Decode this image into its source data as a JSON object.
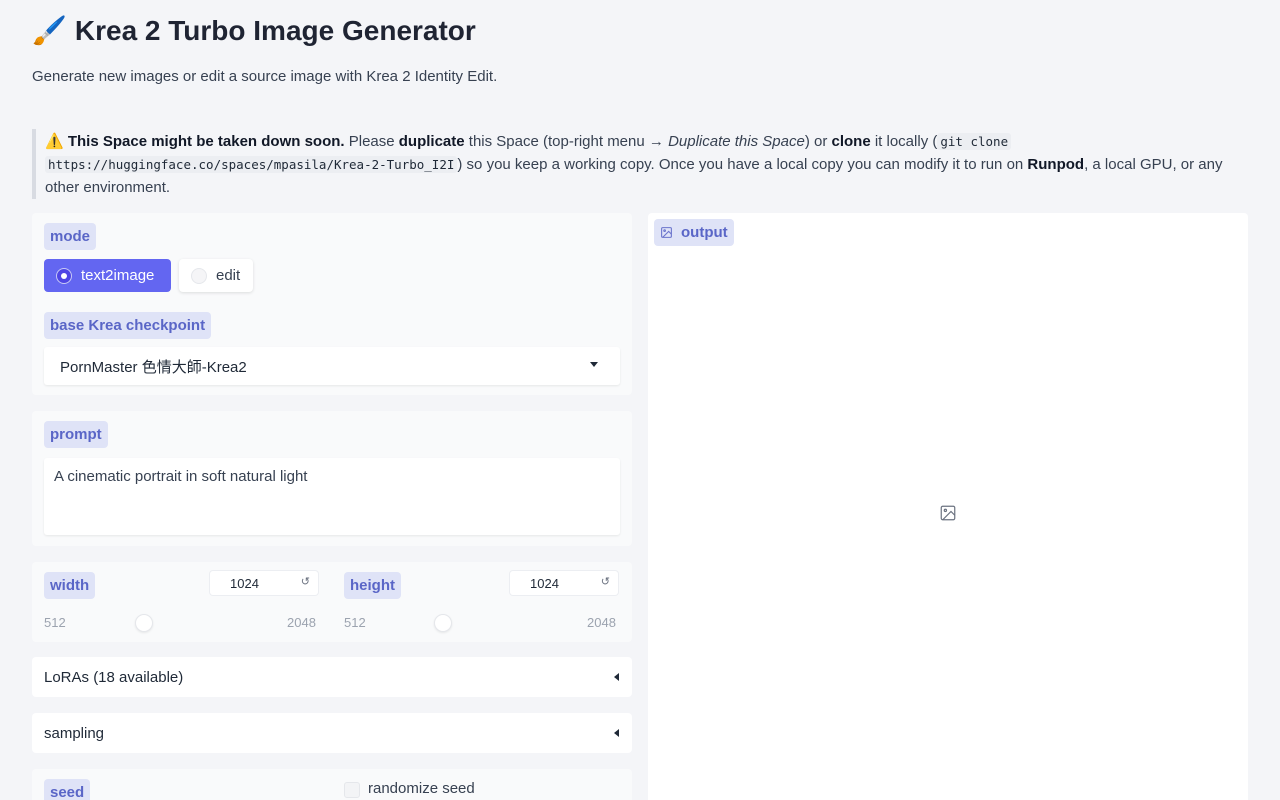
{
  "header": {
    "emoji": "🖌️",
    "title": "Krea 2 Turbo Image Generator",
    "subtitle": "Generate new images or edit a source image with Krea 2 Identity Edit."
  },
  "notice": {
    "warning_emoji": "⚠️",
    "bold_lead": "This Space might be taken down soon.",
    "t1": " Please ",
    "b_duplicate": "duplicate",
    "t2": " this Space (top-right menu → ",
    "i_duplicate": "Duplicate this Space",
    "t3": ") or ",
    "b_clone": "clone",
    "t4": " it locally (",
    "code1": "git clone",
    "code2": "https://huggingface.co/spaces/mpasila/Krea-2-Turbo_I2I",
    "t5": ") so you keep a working copy. Once you have a local copy you can modify it to run on ",
    "b_runpod": "Runpod",
    "t6": ", a local GPU, or any other environment."
  },
  "mode": {
    "label": "mode",
    "options": [
      "text2image",
      "edit"
    ],
    "selected": "text2image"
  },
  "checkpoint": {
    "label": "base Krea checkpoint",
    "value": "PornMaster 色情大師-Krea2"
  },
  "prompt": {
    "label": "prompt",
    "value": "A cinematic portrait in soft natural light"
  },
  "width": {
    "label": "width",
    "value": "1024",
    "min": "512",
    "max": "2048",
    "reset": "↺"
  },
  "height": {
    "label": "height",
    "value": "1024",
    "min": "512",
    "max": "2048",
    "reset": "↺"
  },
  "loras": {
    "label": "LoRAs (18 available)"
  },
  "sampling": {
    "label": "sampling"
  },
  "seed": {
    "label": "seed",
    "randomize_label": "randomize seed"
  },
  "output": {
    "label": "output",
    "icon": "image-icon"
  }
}
